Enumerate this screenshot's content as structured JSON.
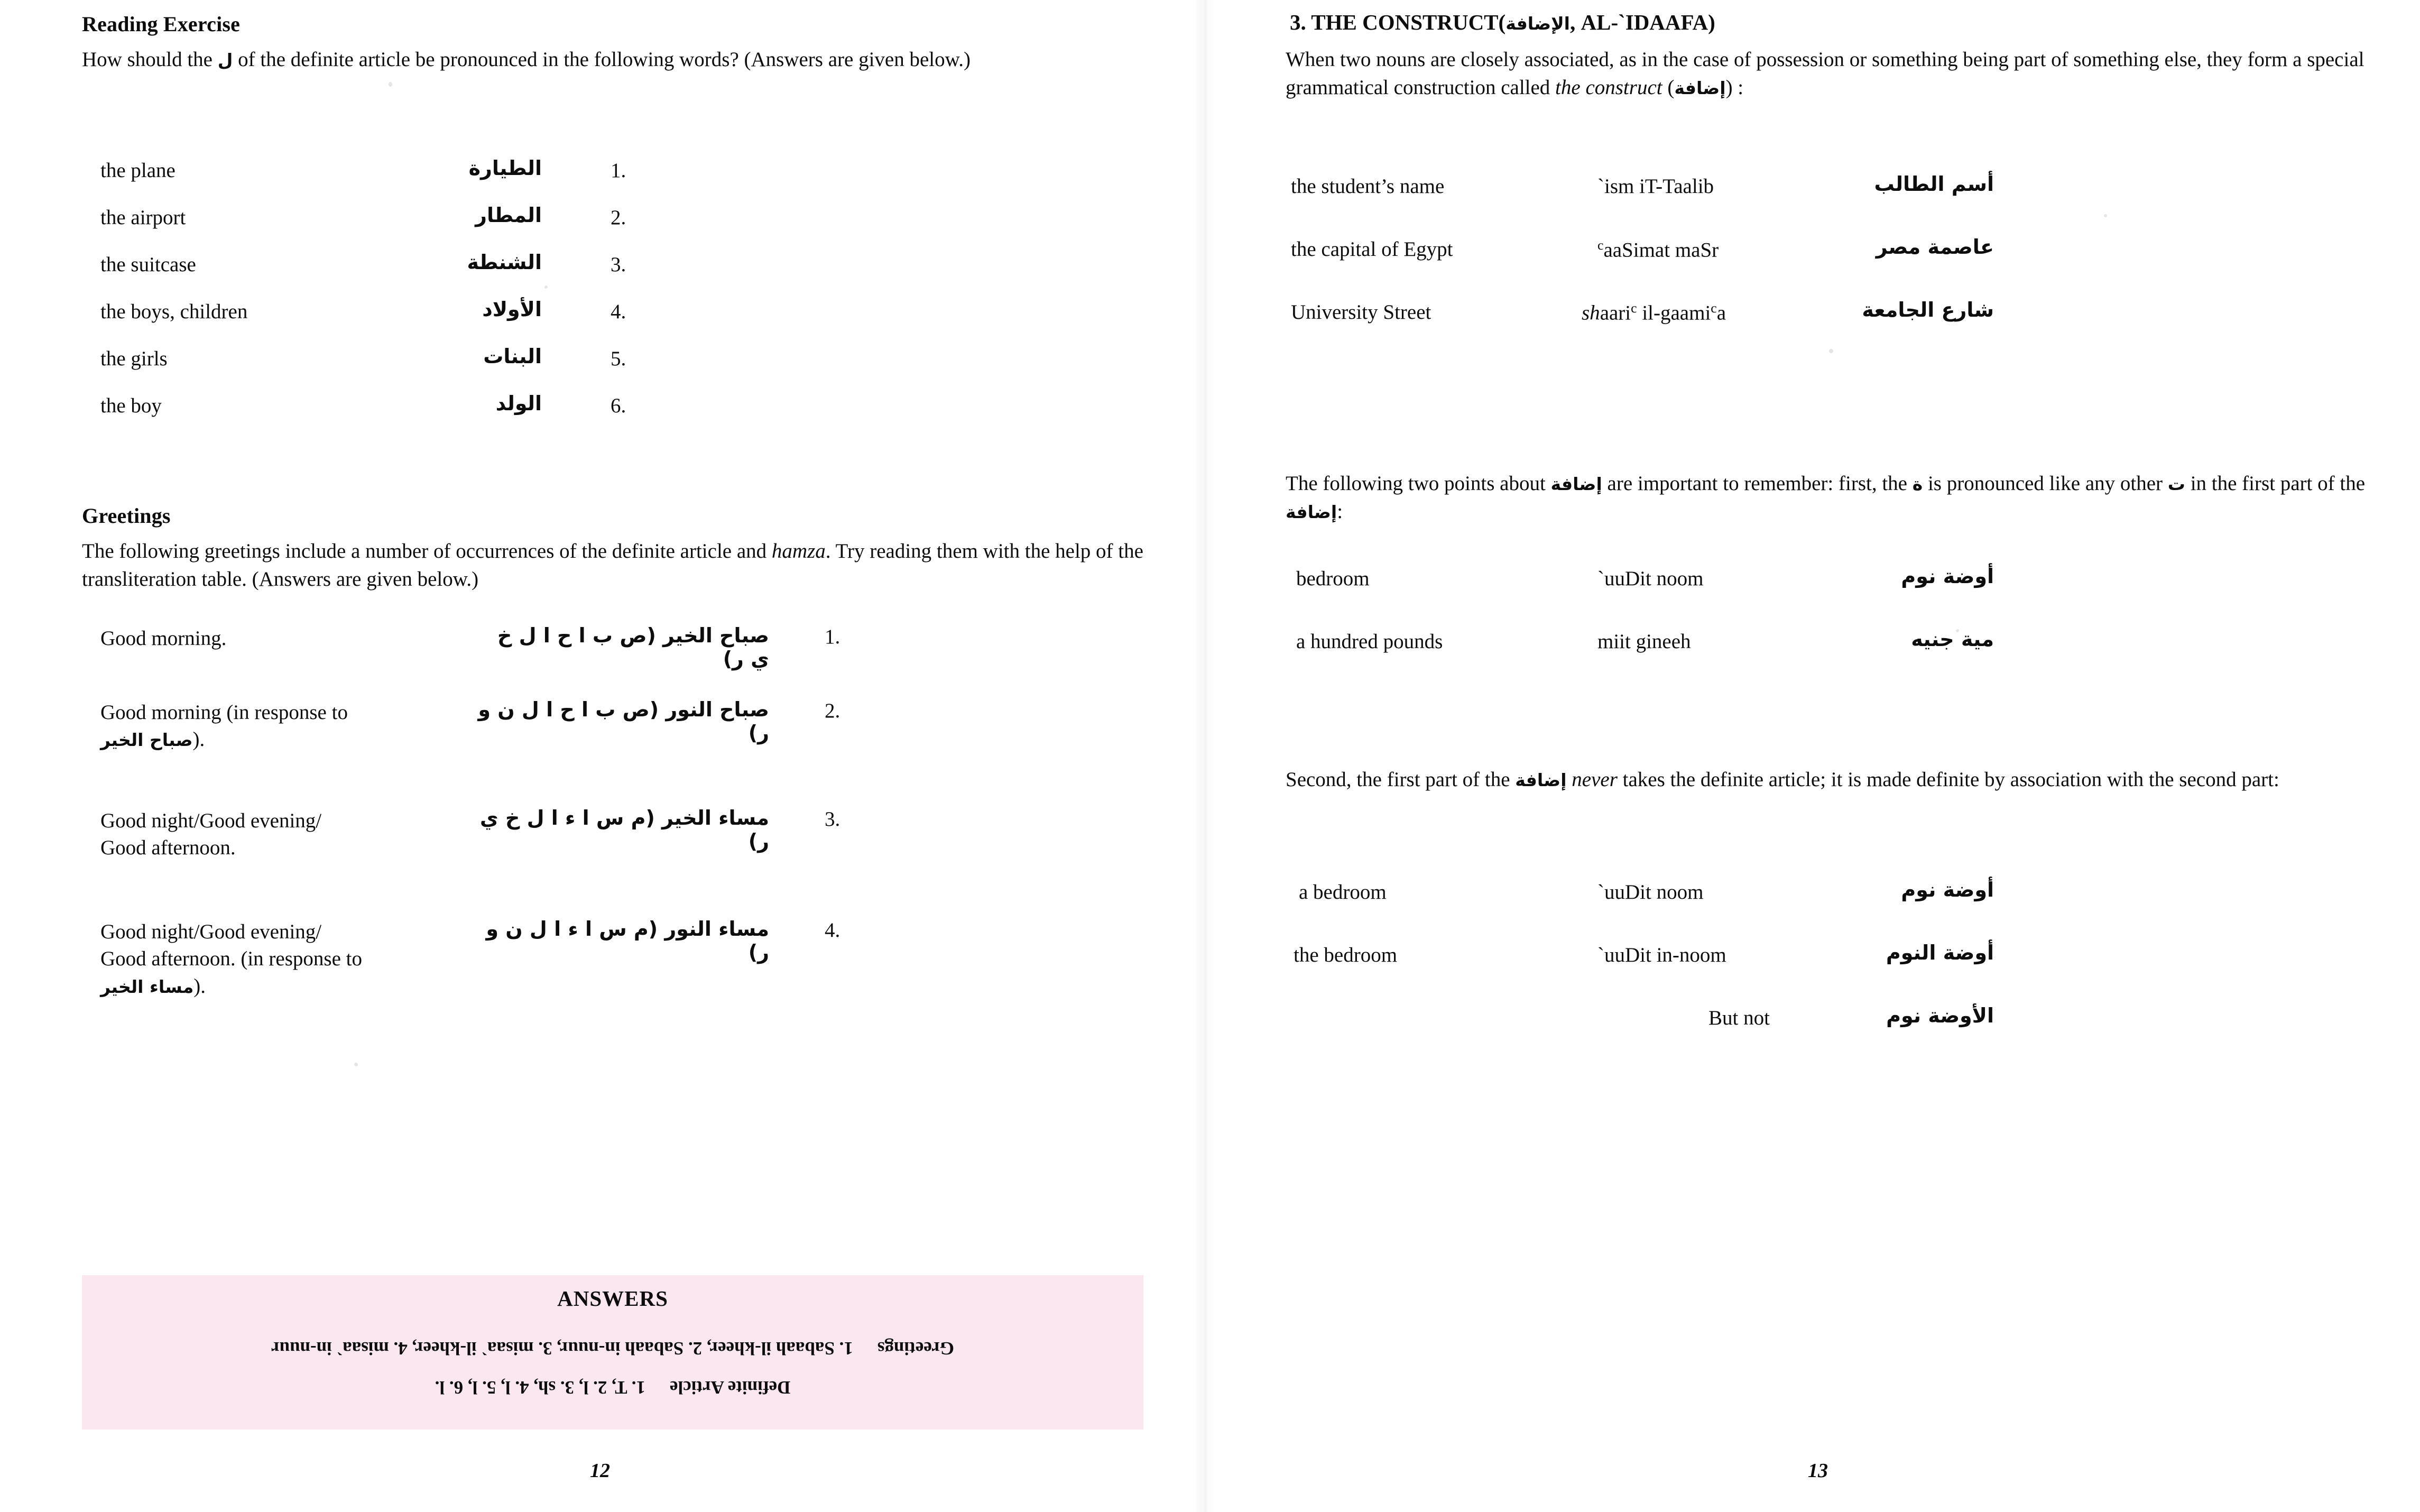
{
  "left_page": {
    "page_number": "12",
    "reading_exercise": {
      "heading": "Reading Exercise",
      "intro": "How should the ل of the definite article be pronounced in the following words? (Answers are given below.)",
      "intro_before": "How should the",
      "intro_arabic_letter": "ل",
      "intro_after": "of the definite article be pronounced in the following words? (Answers are given below.)",
      "items": [
        {
          "number": "1.",
          "english": "the plane",
          "arabic": "الطيارة"
        },
        {
          "number": "2.",
          "english": "the airport",
          "arabic": "المطار"
        },
        {
          "number": "3.",
          "english": "the suitcase",
          "arabic": "الشنطة"
        },
        {
          "number": "4.",
          "english": "the boys, children",
          "arabic": "الأولاد"
        },
        {
          "number": "5.",
          "english": "the girls",
          "arabic": "البنات"
        },
        {
          "number": "6.",
          "english": "the boy",
          "arabic": "الولد"
        }
      ]
    },
    "greetings": {
      "heading": "Greetings",
      "intro_part1": "The following greetings include a number of occurrences of the definite article and",
      "intro_italic": "hamza",
      "intro_part2": ". Try reading them with the help of the transliteration table. (Answers are given below.)",
      "items": [
        {
          "number": "1.",
          "english": "Good morning.",
          "arabic": "صباح الخير (ص ب ا ح ا ل خ ي ر)"
        },
        {
          "number": "2.",
          "english_part1": "Good morning (in response to",
          "english_arabic": "صباح الخير",
          "english_part2": ").",
          "arabic": "صباح النور (ص ب ا ح ا ل ن و ر)"
        },
        {
          "number": "3.",
          "english": "Good night/Good evening/ Good afternoon.",
          "arabic": "مساء الخير (م س ا ء ا ل خ ي ر)"
        },
        {
          "number": "4.",
          "english_part1": "Good night/Good evening/ Good afternoon. (in response to",
          "english_arabic": "مساء الخير",
          "english_part2": ").",
          "arabic": "مساء النور (م س ا ء ا ل ن و ر)"
        }
      ]
    },
    "answers_box": {
      "title": "ANSWERS",
      "background_color": "#fbe7f0",
      "rows": [
        {
          "label": "Greetings",
          "body": "1. Sabaah il-kheer, 2. Sabaah in-nuur, 3. misaa` il-kheer, 4. misaa` in-nuur"
        },
        {
          "label": "Definite Article",
          "body": "1. T, 2. l, 3. sh, 4. l, 5. l, 6. l."
        }
      ]
    }
  },
  "right_page": {
    "page_number": "13",
    "section": {
      "number": "3.",
      "title_en": "THE CONSTRUCT",
      "title_paren_open": "(",
      "title_arabic": "الإضافة",
      "title_translit": ", AL-`IDAAFA)",
      "intro_part1": "When two nouns are closely associated, as in the case of possession or something being part of something else, they form a special grammatical construction called",
      "intro_italic": "the construct",
      "intro_paren_open": "(",
      "intro_arabic": "إضافة",
      "intro_part2": ") :"
    },
    "examples_1": [
      {
        "english": "the student’s name",
        "translit_pre": "`ism iT-Taalib",
        "arabic": "أسم الطالب"
      },
      {
        "english": "the capital of Egypt",
        "translit_pre": "aaSimat maSr",
        "translit_sup": "c",
        "translit_sup_first": true,
        "arabic": "عاصمة مصر"
      },
      {
        "english": "University Street",
        "translit_pre": "shaari",
        "arabic": "شارع الجامعة"
      }
    ],
    "example_university_translit": {
      "italic_part": "sh",
      "rest1": "aari",
      "sup1": "c",
      "rest2": " il-gaami",
      "sup2": "c",
      "rest3": "a"
    },
    "points_para": {
      "part1": "The following two points about",
      "arabic1": "إضافة",
      "part2": "are important to remember: first, the",
      "arabic2": "ة",
      "part3": "is pronounced like any other",
      "arabic3": "ت",
      "part4": "in the first part of the",
      "arabic4": "إضافة",
      "part5": ":"
    },
    "examples_2": [
      {
        "english": "bedroom",
        "translit": "`uuDit noom",
        "arabic": "أوضة نوم"
      },
      {
        "english": "a hundred pounds",
        "translit": "miit gineeh",
        "arabic": "مية جنيه"
      }
    ],
    "second_para": {
      "part1": "Second, the first part of the",
      "arabic1": "إضافة",
      "italic": "never",
      "part2": "takes the definite article; it is made definite by association with the second part:"
    },
    "examples_3": [
      {
        "english": "a bedroom",
        "translit": "`uuDit noom",
        "arabic": "أوضة نوم"
      },
      {
        "english": "the bedroom",
        "translit": "`uuDit in-noom",
        "arabic": "أوضة النوم"
      },
      {
        "english": "",
        "translit": "But not",
        "arabic": "الأوضة نوم"
      }
    ]
  }
}
